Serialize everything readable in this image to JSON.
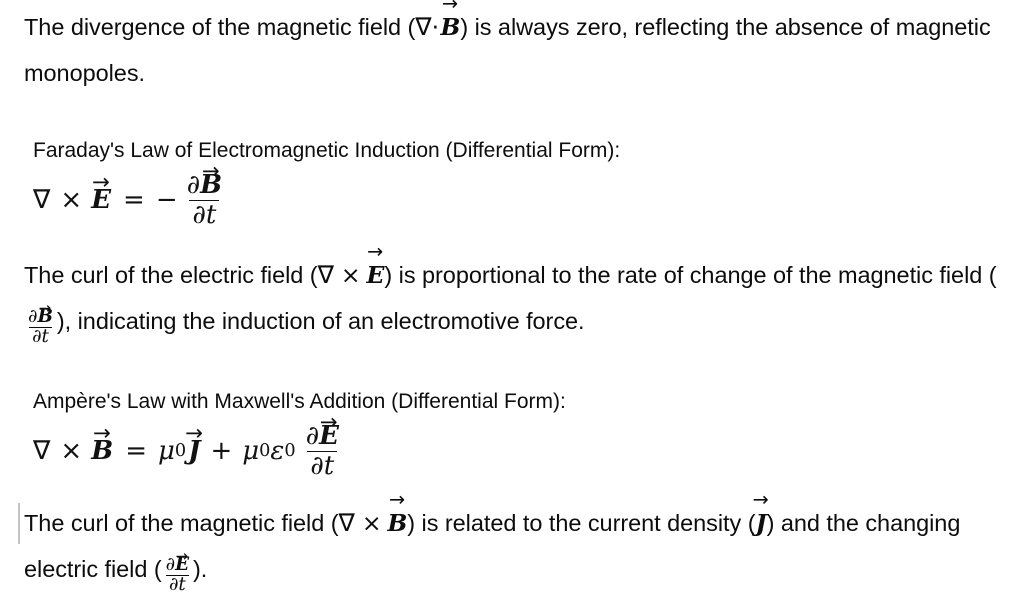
{
  "document": {
    "background_color": "#ffffff",
    "text_color": "#0d0d0d",
    "caret_color": "#c4c4c4",
    "paragraph_1": {
      "part_1": "The divergence of the magnetic field (",
      "math_nabla": "∇",
      "math_dot": "·",
      "math_vector": "B",
      "part_2": ") is always zero, reflecting the absence of magnetic monopoles."
    },
    "section_faraday": {
      "heading": "Faraday's Law of Electromagnetic Induction (Differential Form):",
      "equation": {
        "nabla": "∇",
        "cross": "×",
        "lhs_vector": "E",
        "equals": "=",
        "minus": "−",
        "frac_numerator_partial": "∂",
        "frac_numerator_vector": "B",
        "frac_denominator_partial": "∂",
        "frac_denominator_var": "t"
      },
      "explanation": {
        "part_1": "The curl of the electric field (",
        "math_nabla": "∇",
        "math_cross": "×",
        "math_vector": "E",
        "part_2": ") is proportional to the rate of change of the magnetic field (",
        "frac_numerator_partial": "∂",
        "frac_numerator_vector": "B",
        "frac_denominator_partial": "∂",
        "frac_denominator_var": "t",
        "part_3": "), indicating the induction of an electromotive force."
      }
    },
    "section_ampere": {
      "heading": "Ampère's Law with Maxwell's Addition (Differential Form):",
      "equation": {
        "nabla": "∇",
        "cross": "×",
        "lhs_vector": "B",
        "equals": "=",
        "mu": "μ",
        "mu_sub": "0",
        "current_vector": "J",
        "plus": "+",
        "mu2": "μ",
        "mu2_sub": "0",
        "epsilon": "ε",
        "epsilon_sub": "0",
        "frac_numerator_partial": "∂",
        "frac_numerator_vector": "E",
        "frac_denominator_partial": "∂",
        "frac_denominator_var": "t"
      },
      "explanation": {
        "part_1": "The curl of the magnetic field (",
        "math_nabla": "∇",
        "math_cross": "×",
        "math_vector": "B",
        "part_2": ") is related to the current density (",
        "math_vector_j": "J",
        "part_3": ") and the changing electric field (",
        "frac_numerator_partial": "∂",
        "frac_numerator_vector": "E",
        "frac_denominator_partial": "∂",
        "frac_denominator_var": "t",
        "part_4": ")."
      }
    },
    "symbols": {
      "vector_arrow": "→",
      "open_paren": "(",
      "close_paren": ")"
    }
  }
}
